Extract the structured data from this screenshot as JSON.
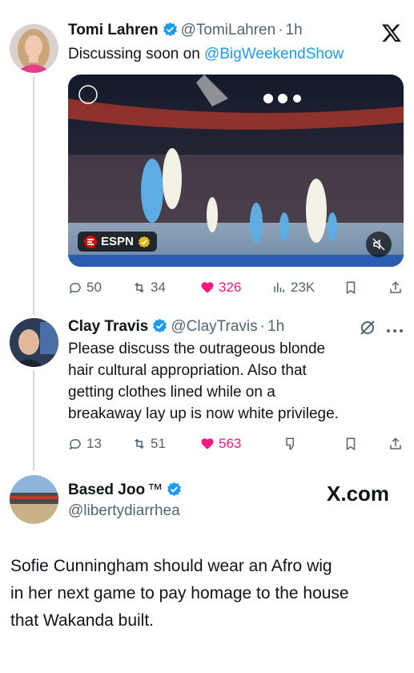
{
  "tweet1": {
    "name": "Tomi Lahren",
    "handle": "@TomiLahren",
    "dot": "·",
    "time": "1h",
    "text_prefix": "Discussing soon on ",
    "mention": "@BigWeekendShow",
    "media": {
      "badge": "ESPN",
      "watermark": "X"
    },
    "stats": {
      "replies": "50",
      "reposts": "34",
      "likes": "326",
      "views": "23K"
    }
  },
  "tweet2": {
    "name": "Clay Travis",
    "handle": "@ClayTravis",
    "dot": "·",
    "time": "1h",
    "lines": [
      "Please discuss the outrageous blonde",
      "hair cultural appropriation. Also that",
      "getting clothes lined while on a",
      "breakaway lay up is now white privilege."
    ],
    "stats": {
      "replies": "13",
      "reposts": "51",
      "likes": "563"
    }
  },
  "tweet3": {
    "name": "Based Joo",
    "tm": "™",
    "handle": "@libertydiarrhea",
    "site": "X.com",
    "lines": [
      "Sofie Cunningham should wear an Afro wig",
      "in her next game to pay homage to the house",
      "that Wakanda built."
    ]
  },
  "colors": {
    "accent": "#1d9bf0",
    "like": "#f91880",
    "muted": "#536471"
  }
}
